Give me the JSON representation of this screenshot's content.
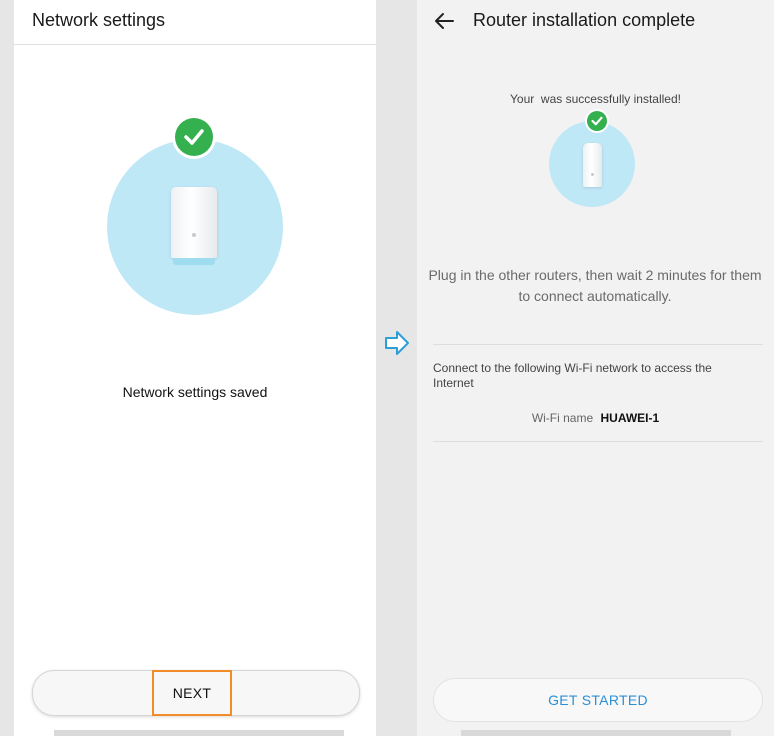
{
  "left": {
    "title": "Network settings",
    "status_message": "Network settings saved",
    "next_button": "NEXT",
    "highlight_color": "#f28c28",
    "icons": {
      "check": "check-icon",
      "router": "router-icon"
    }
  },
  "arrow": {
    "icon": "right-arrow-icon",
    "color": "#2b9fd8"
  },
  "right": {
    "title": "Router installation complete",
    "success_message": "Your  was successfully installed!",
    "instruction": "Plug in the other routers, then wait 2 minutes for them to connect automatically.",
    "connect_text": "Connect to the following Wi-Fi network to access the Internet",
    "wifi_label": "Wi-Fi name",
    "wifi_name": "HUAWEI-1",
    "get_started_button": "GET STARTED",
    "accent_color": "#2b8fd6",
    "icons": {
      "back": "back-arrow-icon",
      "check": "check-icon",
      "router": "router-icon"
    }
  }
}
